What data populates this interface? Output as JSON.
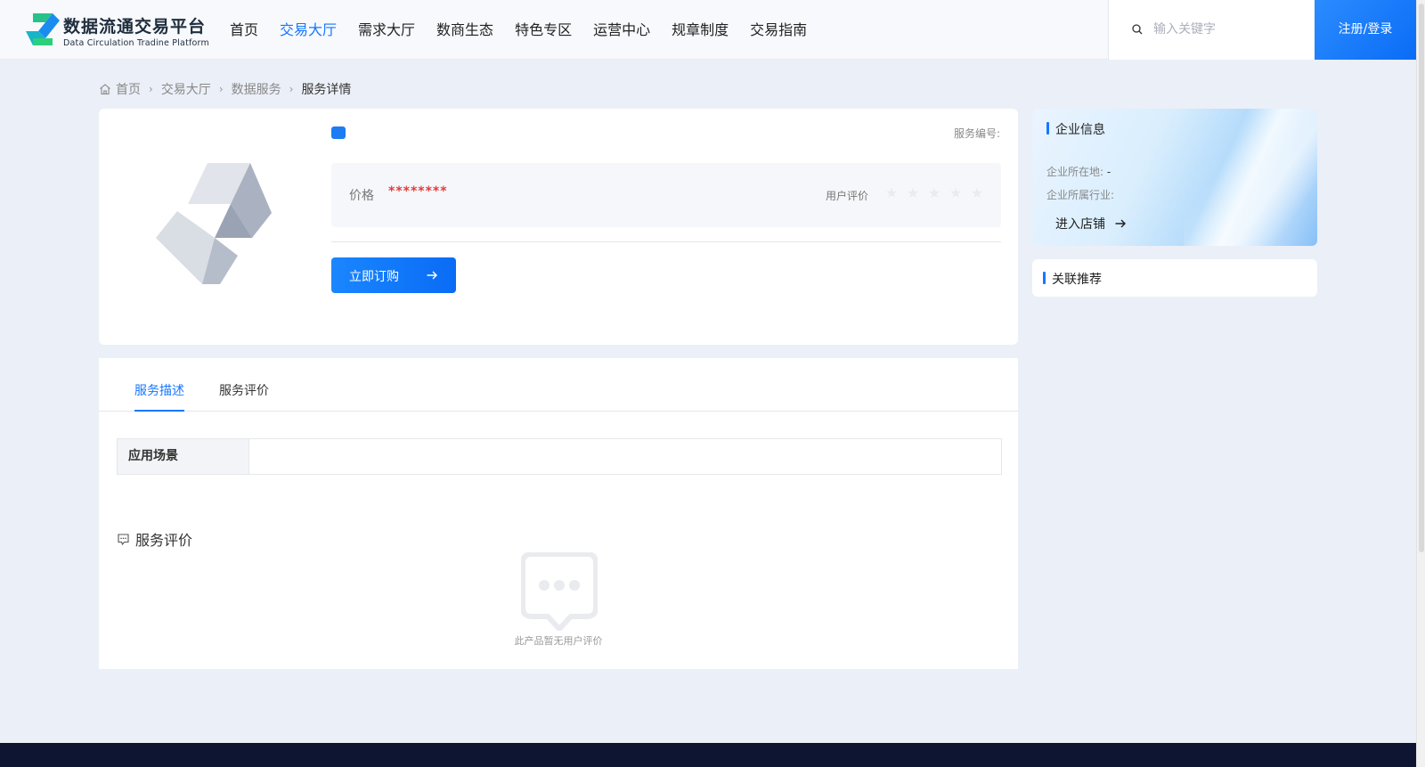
{
  "header": {
    "logo_title": "数据流通交易平台",
    "logo_subtitle": "Data Circulation Tradine Platform",
    "nav": [
      {
        "label": "首页",
        "active": false
      },
      {
        "label": "交易大厅",
        "active": true
      },
      {
        "label": "需求大厅",
        "active": false
      },
      {
        "label": "数商生态",
        "active": false
      },
      {
        "label": "特色专区",
        "active": false
      },
      {
        "label": "运营中心",
        "active": false
      },
      {
        "label": "规章制度",
        "active": false
      },
      {
        "label": "交易指南",
        "active": false
      }
    ],
    "search_placeholder": "输入关键字",
    "login_label": "注册/登录"
  },
  "breadcrumb": [
    "首页",
    "交易大厅",
    "数据服务",
    "服务详情"
  ],
  "product": {
    "service_no_label": "服务编号:",
    "price_label": "价格",
    "price_value": "********",
    "rating_label": "用户评价",
    "rating_stars": 5,
    "rating_value": 0,
    "order_label": "立即订购"
  },
  "tabs": [
    {
      "label": "服务描述",
      "active": true
    },
    {
      "label": "服务评价",
      "active": false
    }
  ],
  "description": {
    "scene_label": "应用场景",
    "scene_value": ""
  },
  "reviews": {
    "title": "服务评价",
    "empty_text": "此产品暂无用户评价"
  },
  "enterprise": {
    "title": "企业信息",
    "location_label": "企业所在地:",
    "location_value": "-",
    "industry_label": "企业所属行业:",
    "industry_value": "",
    "store_link": "进入店铺"
  },
  "related": {
    "title": "关联推荐"
  },
  "colors": {
    "accent": "#1677ff",
    "price": "#e33b3b",
    "footer": "#0d1533"
  }
}
